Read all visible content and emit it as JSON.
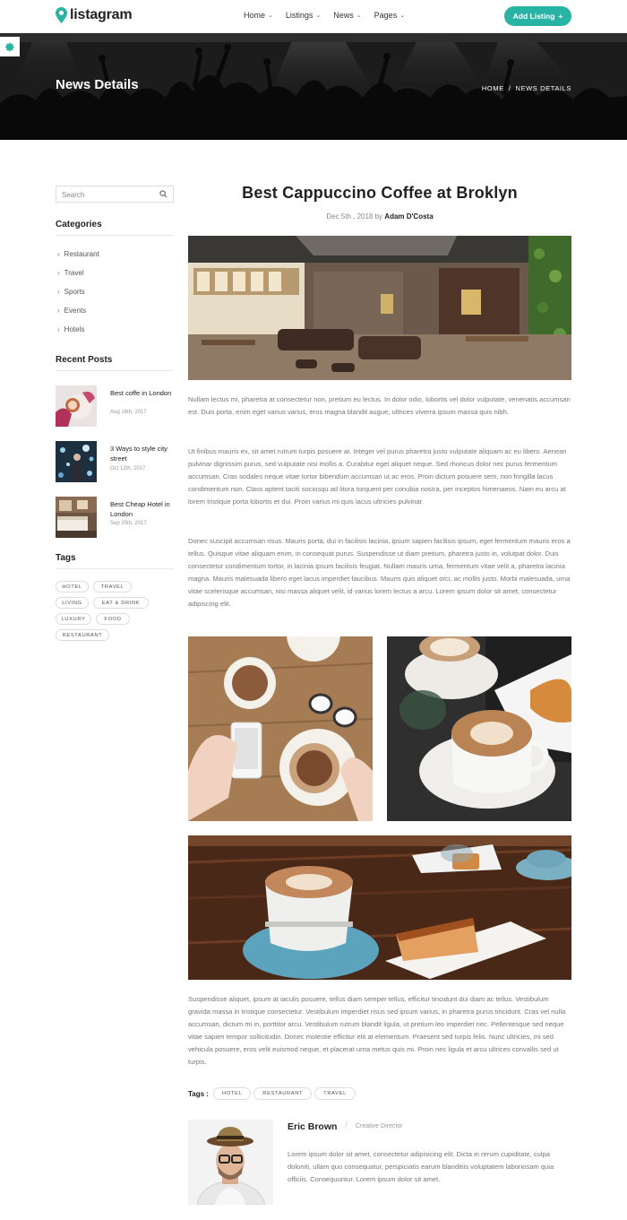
{
  "header": {
    "brand": "listagram",
    "nav": [
      "Home",
      "Listings",
      "News",
      "Pages"
    ],
    "add_listing": "Add Listing",
    "add_icon": "+"
  },
  "hero": {
    "title": "News Details",
    "breadcrumb": [
      "HOME",
      "/",
      "NEWS DETAILS"
    ]
  },
  "sidebar": {
    "search_placeholder": "Search",
    "categories_heading": "Categories",
    "categories": [
      "Restaurant",
      "Travel",
      "Sports",
      "Events",
      "Hotels"
    ],
    "recent_heading": "Recent Posts",
    "recent_posts": [
      {
        "title": "Best coffe in London",
        "date": "Aug 16th, 2017"
      },
      {
        "title": "3 Ways to style city street",
        "date": "Oct 12th, 2017"
      },
      {
        "title": "Best Cheap Hotel in London",
        "date": "Sep 25th, 2017"
      }
    ],
    "tags_heading": "Tags",
    "tags": [
      "HOTEL",
      "TRAVEL",
      "LIVING",
      "EAT & DRINK",
      "LUXURY",
      "FOOD",
      "RESTAURANT"
    ]
  },
  "article": {
    "title": "Best Cappuccino Coffee at Broklyn",
    "date": "Dec 5th , 2018 by",
    "author": "Adam D'Costa",
    "paragraphs": [
      "Nullam lectus mi, pharetra at consectetur non, pretium eu lectus. In dolor odio, lobortis vel dolor vulputate, venenatis accumsan est. Duis porta, enim eget varius varius, eros magna blandit augue, ultrices viverra ipsum massa quis nibh.",
      "Ut finibus mauris ex, sit amet rutrum turpis posuere at. Integer vel purus pharetra justo vulputate aliquam ac eu libero. Aenean pulvinar dignissim purus, sed vulputate nisi mollis a. Curabitur eget aliquet neque. Sed rhoncus dolor nec purus fermentum accumsan. Cras sodales neque vitae tortor bibendum accumsan ut ac eros. Proin dictum posuere sem, non fringilla lacus condimentum non. Class aptent taciti sociosqu ad litora torquent per conubia nostra, per inceptos himenaeos. Nam eu arcu at lorem tristique porta lobortis et dui. Proin varius mi quis lacus ultricies pulvinar.",
      "Donec suscipit accumsan risus. Mauris porta, dui in facilisis lacinia, ipsum sapien facilisis ipsum, eget fermentum mauris eros a tellus. Quisque vitae aliquam enim, in consequat purus. Suspendisse ut diam pretium, pharetra justo in, volutpat dolor. Duis consectetur condimentum tortor, in lacinia ipsum facilisis feugiat. Nullam mauris urna, fermentum vitae velit a, pharetra lacinia magna. Mauris malesuada libero eget lacus imperdiet faucibus. Mauris quis aliquet orci, ac mollis justo. Morbi malesuada, urna vitae scelerisque accumsan, nisi massa aliquet velit, id varius lorem lectus a arcu. Lorem ipsum dolor sit amet, consectetur adipiscing elit.",
      "Suspendisse aliquet, ipsum at iaculis posuere, tellus diam semper tellus, efficitur tincidunt dui diam ac tellus. Vestibulum gravida massa in tristique consectetur. Vestibulum imperdiet risus sed ipsum varius, in pharetra purus tincidunt. Cras vel nulla accumsan, dictum mi in, porttitor arcu. Vestibulum rutrum blandit ligula, ut pretium leo imperdiet nec. Pellentesque sed neque vitae sapien tempor sollicitudin. Donec molestie efficitur elit at elementum. Praesent sed turpis felis. Nunc ultricies, mi sed vehicula posuere, eros velit euismod neque, et placerat urna metus quis mi. Proin nec ligula et arcu ultrices convallis sed ut turpis."
    ],
    "tags_label": "Tags :",
    "tags": [
      "HOTEL",
      "RESTAURANT",
      "TRAVEL"
    ]
  },
  "author_box": {
    "name": "Eric Brown",
    "separator": "/",
    "role": "Creative Director",
    "bio": "Lorem ipsum dolor sit amet, consectetur adipisicing elit. Dicta in rerum cupiditate, culpa doloniti, ullam quo consequatur, perspiciatis earum blanditiis voluptatem laboriosam quia officiis. Consequuntur. Lorem ipsum dolor sit amet."
  },
  "colors": {
    "accent": "#29b3a4",
    "text": "#222222",
    "muted": "#777777"
  },
  "icons": {
    "logo": "map-pin-icon",
    "settings": "gear-icon",
    "search": "search-icon",
    "nav_dropdown": "chevron-down-icon",
    "category_bullet": "chevron-right-icon"
  }
}
